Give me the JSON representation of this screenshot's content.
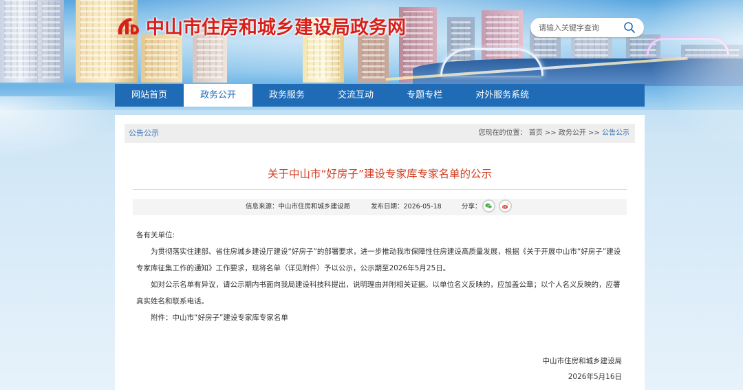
{
  "header": {
    "site_title": "中山市住房和城乡建设局政务网",
    "search_placeholder": "请输入关键字查询"
  },
  "nav": {
    "items": [
      {
        "label": "网站首页",
        "active": false
      },
      {
        "label": "政务公开",
        "active": true
      },
      {
        "label": "政务服务",
        "active": false
      },
      {
        "label": "交流互动",
        "active": false
      },
      {
        "label": "专题专栏",
        "active": false
      },
      {
        "label": "对外服务系统",
        "active": false
      }
    ]
  },
  "breadcrumb": {
    "section": "公告公示",
    "location_label": "您现在的位置：",
    "path": [
      "首页",
      "政务公开",
      "公告公示"
    ],
    "separator": ">>"
  },
  "article": {
    "title": "关于中山市“好房子”建设专家库专家名单的公示",
    "source_label": "信息来源：",
    "source": "中山市住房和城乡建设局",
    "date_label": "发布日期：",
    "date": "2026-05-18",
    "share_label": "分享：",
    "greeting": "各有关单位:",
    "paragraphs": [
      "为贯彻落实住建部、省住房城乡建设厅建设“好房子”的部署要求，进一步推动我市保障性住房建设高质量发展，根据《关于开展中山市“好房子”建设专家库征集工作的通知》工作要求，现将名单（详见附件）予以公示，公示期至2026年5月25日。",
      "如对公示名单有异议，请公示期内书面向我局建设科技科提出，说明理由并附相关证据。以单位名义反映的，应加盖公章；以个人名义反映的，应署真实姓名和联系电话。",
      "附件：中山市“好房子”建设专家库专家名单"
    ],
    "signature_org": "中山市住房和城乡建设局",
    "signature_date": "2026年5月16日"
  },
  "colors": {
    "title_red": "#d8201a",
    "nav_blue": "#1f6bb5",
    "article_title": "#d23c1f",
    "link_blue": "#2a6db6"
  },
  "icons": {
    "logo": "zhongshan-logo-icon",
    "search": "search-icon",
    "wechat": "wechat-icon",
    "weibo": "weibo-icon"
  }
}
